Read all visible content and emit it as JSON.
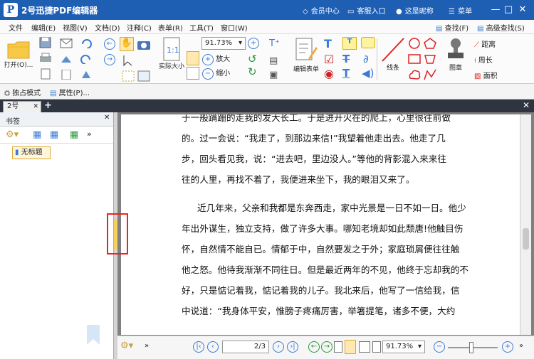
{
  "app": {
    "title": "2号迅捷PDF编辑器",
    "logo_letter": "P"
  },
  "titlebar": {
    "member_center": "会员中心",
    "support": "客服入口",
    "nickname": "这是昵称",
    "menu": "菜单"
  },
  "menu": [
    "文件",
    "编辑(E)",
    "视图(V)",
    "文档(D)",
    "注释(C)",
    "表单(R)",
    "工具(T)",
    "窗口(W)"
  ],
  "menu_right": {
    "find": "查找(F)",
    "advanced_find": "高级查找(S)"
  },
  "ribbon": {
    "open": "打开(O)...",
    "zoom_value": "91.73%",
    "actual_size": "实际大小",
    "zoom_in": "放大",
    "zoom_out": "缩小",
    "edit_form": "编辑表单",
    "lines": "线条",
    "stamp": "图章",
    "distance": "距离",
    "perimeter": "周长",
    "area": "面积"
  },
  "quickbar": {
    "exclusive_mode": "独占模式",
    "properties": "属性(P)..."
  },
  "tabs": {
    "doc_tab": "2号"
  },
  "sidebar": {
    "title": "书签",
    "bookmark": "无标题"
  },
  "document": {
    "lines": [
      "于一般蹒跚的走我的发大长工。于是进开火在的爬上，心里很往前做",
      "的。过一会说：“我走了，到那边来信!”我望着他走出去。他走了几",
      "步，回头看见我，说：“进去吧，里边没人。”等他的背影混入来来往",
      "往的人里，再找不着了，我便进来坐下，我的眼泪又来了。",
      "近几年来，父亲和我都是东奔西走，家中光景是一日不如一日。他少",
      "年出外谋生，独立支持，做了许多大事。哪知老境却如此颓唐!他触目伤",
      "怀，自然情不能自已。情郁于中，自然要发之于外；家庭琐屑便往往触",
      "他之怒。他待我渐渐不同往日。但是最近两年的不见，他终于忘却我的不",
      "好，只是惦记着我，惦记着我的儿子。我北来后，他写了一信给我，信",
      "中说道：“我身体平安，惟膀子疼痛厉害，举箸提笔，诸多不便，大约"
    ]
  },
  "statusbar": {
    "page_display": "2/3",
    "zoom_value": "91.73%"
  },
  "colors": {
    "titlebar": "#1e5fb4",
    "accent": "#3a7bd5",
    "highlight_box": "#e22222",
    "tabbar": "#2e3440"
  }
}
